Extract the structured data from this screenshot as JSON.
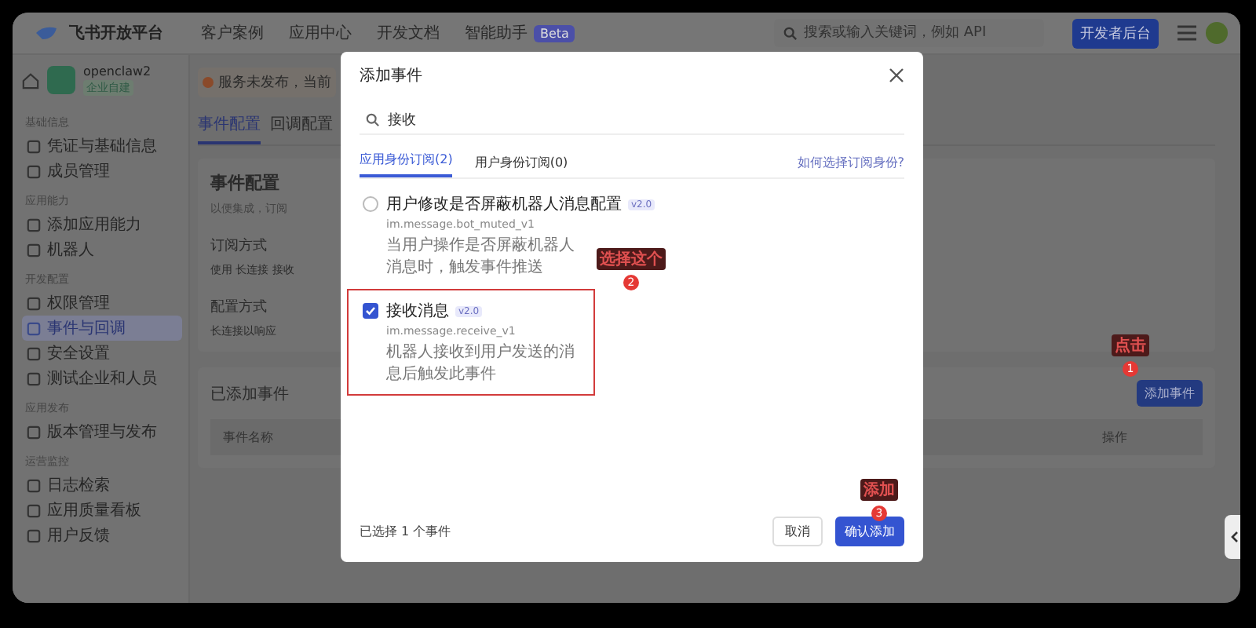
{
  "header": {
    "logo": "飞书开放平台",
    "nav": [
      "客户案例",
      "应用中心",
      "开发文档",
      "智能助手"
    ],
    "nav_badge": "Beta",
    "search": {
      "placeholder": "搜索或输入关键词，例如 API"
    },
    "button": "开发者后台"
  },
  "app": {
    "name": "openclaw2",
    "tag": "企业自建"
  },
  "notice": "服务未发布，当前",
  "sidebar": [
    {
      "title": "基础信息",
      "items": [
        {
          "label": "凭证与基础信息",
          "selected": false
        },
        {
          "label": "成员管理",
          "selected": false
        }
      ]
    },
    {
      "title": "应用能力",
      "items": [
        {
          "label": "添加应用能力",
          "selected": false
        },
        {
          "label": "机器人",
          "selected": false
        }
      ]
    },
    {
      "title": "开发配置",
      "items": [
        {
          "label": "权限管理",
          "selected": false
        },
        {
          "label": "事件与回调",
          "selected": true
        },
        {
          "label": "安全设置",
          "selected": false
        },
        {
          "label": "测试企业和人员",
          "selected": false
        }
      ]
    },
    {
      "title": "应用发布",
      "items": [
        {
          "label": "版本管理与发布",
          "selected": false
        }
      ]
    },
    {
      "title": "运营监控",
      "items": [
        {
          "label": "日志检索",
          "selected": false
        },
        {
          "label": "应用质量看板",
          "selected": false
        },
        {
          "label": "用户反馈",
          "selected": false
        }
      ]
    }
  ],
  "tabs": [
    {
      "label": "事件配置",
      "selected": true
    },
    {
      "label": "回调配置",
      "selected": false
    }
  ],
  "content": {
    "heading": "事件配置",
    "subtitle": "以便集成，订阅",
    "subscribe_label": "订阅方式",
    "subscribe_value": "使用 长连接 接收",
    "config_label": "配置方式",
    "config_value": "长连接以响应",
    "added_heading": "已添加事件",
    "add_button": "添加事件",
    "columns": [
      "事件名称",
      "操作"
    ]
  },
  "modal": {
    "title": "添加事件",
    "search": {
      "value": "接收"
    },
    "tabs": [
      {
        "label": "应用身份订阅(2)",
        "selected": true
      },
      {
        "label": "用户身份订阅(0)",
        "selected": false
      }
    ],
    "help_link": "如何选择订阅身份?",
    "events": [
      {
        "name": "用户修改是否屏蔽机器人消息配置",
        "badge": "v2.0",
        "code": "im.message.bot_muted_v1",
        "description": "当用户操作是否屏蔽机器人消息时，触发事件推送",
        "checked": false
      },
      {
        "name": "接收消息",
        "badge": "v2.0",
        "code": "im.message.receive_v1",
        "description": "机器人接收到用户发送的消息后触发此事件",
        "checked": true
      }
    ],
    "footer_text": "已选择 1 个事件",
    "cancel": "取消",
    "confirm": "确认添加"
  },
  "annotations": [
    {
      "label": "点击",
      "step": "1"
    },
    {
      "label": "选择这个",
      "step": "2"
    },
    {
      "label": "添加",
      "step": "3"
    }
  ]
}
